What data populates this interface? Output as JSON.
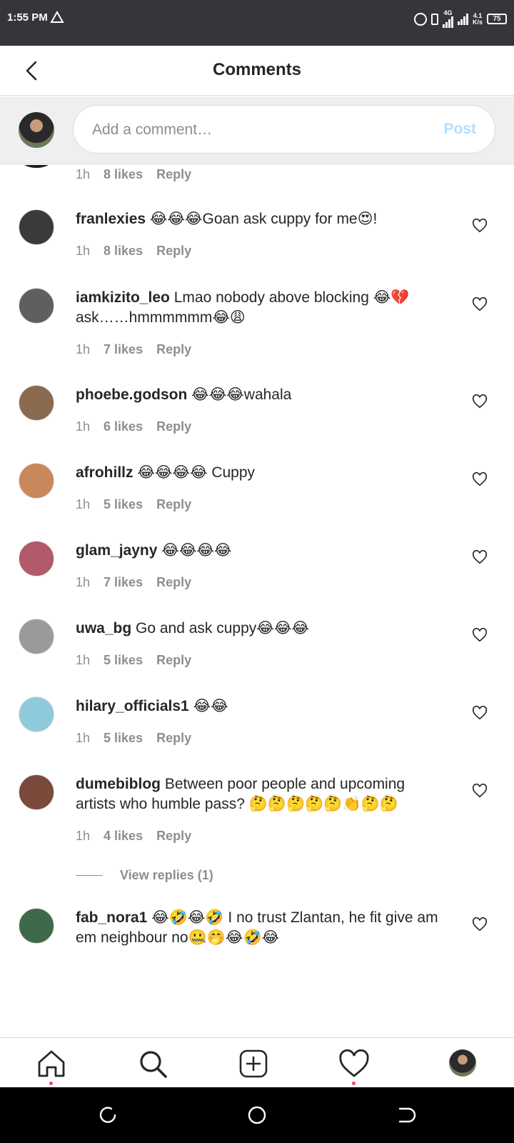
{
  "status_bar": {
    "time": "1:55 PM",
    "network_top": "4G",
    "speed_top": "4.1",
    "speed_unit": "K/s",
    "battery": "75"
  },
  "header": {
    "title": "Comments"
  },
  "composer": {
    "placeholder": "Add a comment…",
    "post_label": "Post"
  },
  "first_meta": {
    "time": "1h",
    "likes": "8 likes",
    "reply": "Reply"
  },
  "comments": [
    {
      "username": "franlexies",
      "text": " 😂😂😂Goan ask cuppy for me😍!",
      "time": "1h",
      "likes": "8 likes",
      "reply": "Reply",
      "avatar_color": "#3a3a3a"
    },
    {
      "username": "iamkizito_leo",
      "text": " Lmao nobody above blocking 😂💔 ask……hmmmmmm😂😩",
      "time": "1h",
      "likes": "7 likes",
      "reply": "Reply",
      "avatar_color": "#5f5f5f"
    },
    {
      "username": "phoebe.godson",
      "text": " 😂😂😂wahala",
      "time": "1h",
      "likes": "6 likes",
      "reply": "Reply",
      "avatar_color": "#8a6a4e"
    },
    {
      "username": "afrohillz",
      "text": " 😂😂😂😂 Cuppy",
      "time": "1h",
      "likes": "5 likes",
      "reply": "Reply",
      "avatar_color": "#c9875c"
    },
    {
      "username": "glam_jayny",
      "text": " 😂😂😂😂",
      "time": "1h",
      "likes": "7 likes",
      "reply": "Reply",
      "avatar_color": "#b05a6a"
    },
    {
      "username": "uwa_bg",
      "text": " Go and ask cuppy😂😂😂",
      "time": "1h",
      "likes": "5 likes",
      "reply": "Reply",
      "avatar_color": "#9a9a9a"
    },
    {
      "username": "hilary_officials1",
      "text": " 😂😂",
      "time": "1h",
      "likes": "5 likes",
      "reply": "Reply",
      "avatar_color": "#8fc9dc"
    },
    {
      "username": "dumebiblog",
      "text": " Between poor people and upcoming artists who humble pass? 🤔🤔🤔🤔🤔👏🤔🤔",
      "time": "1h",
      "likes": "4 likes",
      "reply": "Reply",
      "avatar_color": "#7a4a3a"
    },
    {
      "username": "fab_nora1",
      "text": " 😂🤣😂🤣 I no trust Zlantan, he fit give am em neighbour no🤐🤭😂🤣😂",
      "time": "",
      "likes": "",
      "reply": "",
      "avatar_color": "#3f6a4a"
    }
  ],
  "view_replies": "View replies (1)",
  "colors": {
    "status_bg": "#34363a",
    "text": "#262626",
    "muted": "#8e8e8e",
    "post_disabled": "#b2dffc",
    "notification_dot": "#ed4956"
  },
  "icons": {
    "nav": [
      "home-icon",
      "search-icon",
      "new-post-icon",
      "activity-heart-icon",
      "profile-avatar"
    ]
  }
}
